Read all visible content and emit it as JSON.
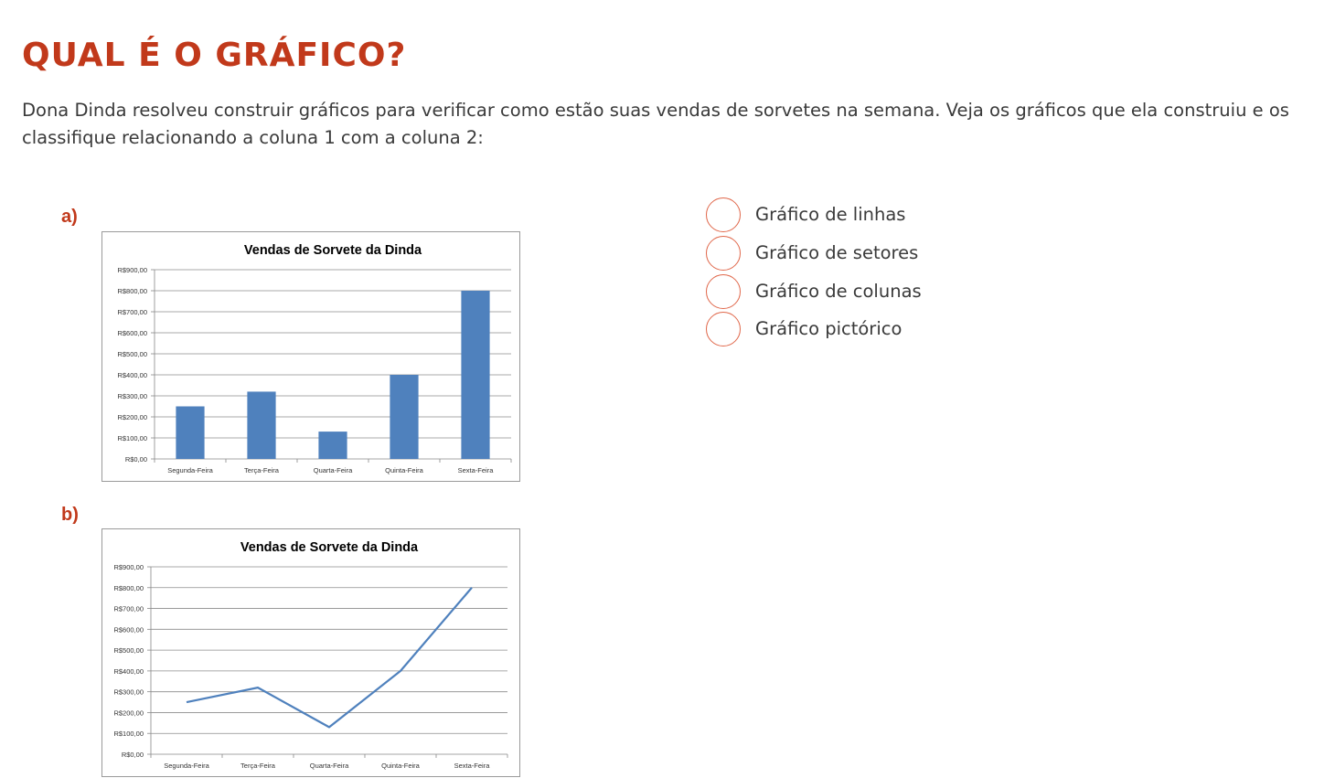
{
  "page": {
    "title": "QUAL É O GRÁFICO?",
    "intro": "Dona Dinda resolveu construir gráficos para verificar como estão suas vendas de sorvetes na semana. Veja os gráficos que ela construiu e os classifique relacionando a coluna 1 com a coluna 2:"
  },
  "items": [
    {
      "label": "a)"
    },
    {
      "label": "b)"
    }
  ],
  "options": [
    {
      "label": "Gráfico de linhas"
    },
    {
      "label": "Gráfico de setores"
    },
    {
      "label": "Gráfico de colunas"
    },
    {
      "label": "Gráfico pictórico"
    }
  ],
  "colors": {
    "accent": "#c1391b",
    "radio_border": "#e0674a",
    "series": "#4f81bd"
  },
  "chart_data": [
    {
      "type": "bar",
      "title": "Vendas de Sorvete da Dinda",
      "categories": [
        "Segunda-Feira",
        "Terça-Feira",
        "Quarta-Feira",
        "Quinta-Feira",
        "Sexta-Feira"
      ],
      "values": [
        250,
        320,
        130,
        400,
        800
      ],
      "ylim": [
        0,
        900
      ],
      "yticks": [
        0,
        100,
        200,
        300,
        400,
        500,
        600,
        700,
        800,
        900
      ],
      "ytick_labels": [
        "R$0,00",
        "R$100,00",
        "R$200,00",
        "R$300,00",
        "R$400,00",
        "R$500,00",
        "R$600,00",
        "R$700,00",
        "R$800,00",
        "R$900,00"
      ],
      "grid": true,
      "legend": "none"
    },
    {
      "type": "line",
      "title": "Vendas de Sorvete da Dinda",
      "categories": [
        "Segunda-Feira",
        "Terça-Feira",
        "Quarta-Feira",
        "Quinta-Feira",
        "Sexta-Feira"
      ],
      "values": [
        250,
        320,
        130,
        400,
        800
      ],
      "ylim": [
        0,
        900
      ],
      "yticks": [
        0,
        100,
        200,
        300,
        400,
        500,
        600,
        700,
        800,
        900
      ],
      "ytick_labels": [
        "R$0,00",
        "R$100,00",
        "R$200,00",
        "R$300,00",
        "R$400,00",
        "R$500,00",
        "R$600,00",
        "R$700,00",
        "R$800,00",
        "R$900,00"
      ],
      "grid": true,
      "legend": "none"
    }
  ]
}
